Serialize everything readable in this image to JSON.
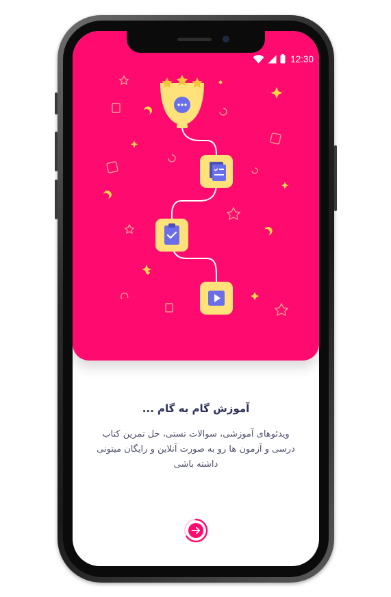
{
  "status_bar": {
    "time": "12:30"
  },
  "onboarding": {
    "title": "آموزش گام به گام ...",
    "description": "ویدئوهای آموزشی، سوالات تستی، حل تمرین کتاب درسی و آزمون ها رو به صورت آنلاین و رایگان میتونی داشته باشی"
  },
  "colors": {
    "accent": "#ff0a6f",
    "tile_yellow": "#ffe27a",
    "icon_blue": "#6a6ee8",
    "star_gold": "#f7c43a",
    "title_text": "#2e3158"
  },
  "illustration": {
    "steps": [
      {
        "icon": "trophy-chat-icon"
      },
      {
        "icon": "checklist-icon"
      },
      {
        "icon": "clipboard-check-icon"
      },
      {
        "icon": "play-video-icon"
      }
    ],
    "stars": 3
  },
  "navigation": {
    "next_icon": "arrow-right-icon"
  }
}
